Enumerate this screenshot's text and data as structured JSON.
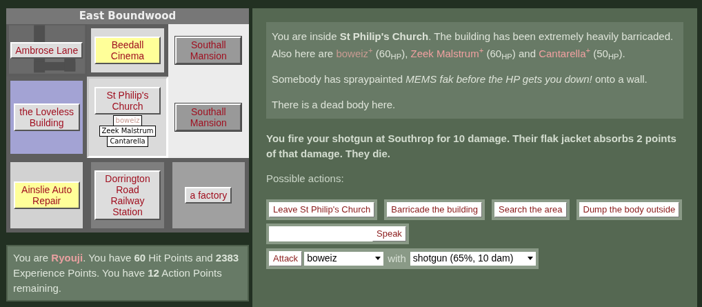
{
  "map": {
    "title": "East Boundwood",
    "cells": [
      {
        "label": "Ambrose Lane",
        "kind": "street",
        "color": "#5c5c5c",
        "lit": false,
        "dim": false,
        "selected": false
      },
      {
        "label": "Beedall Cinema",
        "kind": "block",
        "color": "#dadada",
        "lit": true,
        "dim": false,
        "selected": false
      },
      {
        "label": "Southall Mansion",
        "kind": "full",
        "color": "#ececec",
        "lit": false,
        "dim": true,
        "selected": false
      },
      {
        "label": "the Loveless Building",
        "kind": "block",
        "color": "#a3a3d4",
        "lit": false,
        "dim": false,
        "selected": false
      },
      {
        "label": "St Philip's Church",
        "kind": "full",
        "color": "#dadada",
        "lit": false,
        "dim": false,
        "selected": true,
        "people": [
          {
            "name": "boweiz",
            "color": "#c89b92"
          },
          {
            "name": "Zeek Malstrum",
            "color": "#000000"
          },
          {
            "name": "Cantarella",
            "color": "#000000"
          }
        ]
      },
      {
        "label": "Southall Mansion",
        "kind": "full",
        "color": "#ececec",
        "lit": false,
        "dim": true,
        "selected": false
      },
      {
        "label": "Ainslie Auto Repair",
        "kind": "block",
        "color": "#d2d2d2",
        "lit": true,
        "dim": false,
        "selected": false
      },
      {
        "label": "Dorrington Road Railway Station",
        "kind": "block",
        "color": "#7e7e7e",
        "lit": false,
        "dim": false,
        "selected": false
      },
      {
        "label": "a factory",
        "kind": "block",
        "color": "#a0a0a0",
        "lit": false,
        "dim": false,
        "selected": false
      }
    ]
  },
  "status": [
    {
      "kind": "text",
      "text": "You are "
    },
    {
      "kind": "name",
      "text": "Ryouji",
      "color": "#e8a0a0"
    },
    {
      "kind": "text",
      "text": ". You have "
    },
    {
      "kind": "bold",
      "text": "60"
    },
    {
      "kind": "text",
      "text": " Hit Points and "
    },
    {
      "kind": "bold",
      "text": "2383"
    },
    {
      "kind": "text",
      "text": " Experience Points. You have "
    },
    {
      "kind": "bold",
      "text": "12"
    },
    {
      "kind": "text",
      "text": " Action Points remaining."
    }
  ],
  "description": [
    [
      {
        "kind": "text",
        "text": "You are inside "
      },
      {
        "kind": "bold",
        "text": "St Philip's Church"
      },
      {
        "kind": "text",
        "text": ". The building has been extremely heavily barricaded. Also here are "
      },
      {
        "kind": "name",
        "text": "boweiz$^{+}$",
        "color": "#c89b92"
      },
      {
        "kind": "text",
        "text": " (60$_{HP}$), "
      },
      {
        "kind": "name",
        "text": "Zeek Malstrum$^{+}$",
        "color": "#f0a0a0"
      },
      {
        "kind": "text",
        "text": " (60$_{HP}$) and "
      },
      {
        "kind": "name",
        "text": "Cantarella$^{+}$",
        "color": "#f0a0a0"
      },
      {
        "kind": "text",
        "text": " (50$_{HP}$)."
      }
    ],
    [
      {
        "kind": "text",
        "text": "Somebody has spraypainted "
      },
      {
        "kind": "italic",
        "text": "MEMS fak before the HP gets you down!"
      },
      {
        "kind": "text",
        "text": " onto a wall."
      }
    ],
    [
      {
        "kind": "text",
        "text": "There is a dead body here."
      }
    ]
  ],
  "message": "You fire your shotgun at Southrop for 10 damage. Their flak jacket absorbs 2 points of that damage. They die.",
  "actions_label": "Possible actions:",
  "actions": [
    "Leave St Philip's Church",
    "Barricade the building",
    "Search the area",
    "Dump the body outside"
  ],
  "speak_button": "Speak",
  "attack": {
    "button": "Attack",
    "target": "boweiz",
    "joiner": "with",
    "weapon": "shotgun (65%, 10 dam)"
  }
}
